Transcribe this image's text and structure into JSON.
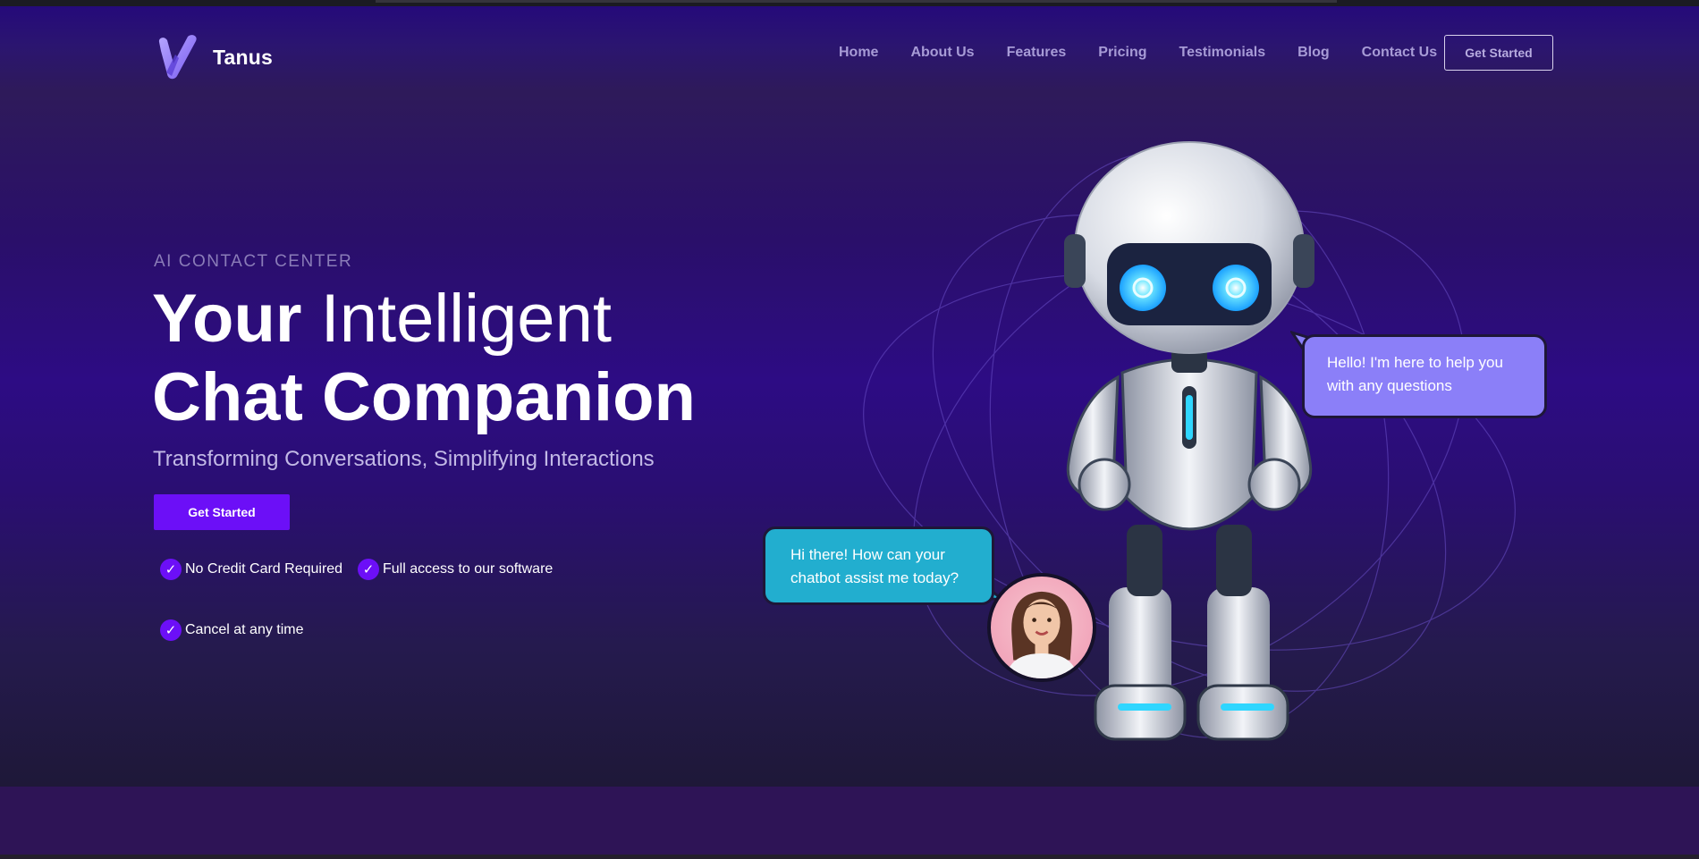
{
  "brand": {
    "name": "Tanus",
    "logo_icon": "v-logo-icon"
  },
  "nav": {
    "items": [
      {
        "label": "Home"
      },
      {
        "label": "About Us"
      },
      {
        "label": "Features"
      },
      {
        "label": "Pricing"
      },
      {
        "label": "Testimonials"
      },
      {
        "label": "Blog"
      },
      {
        "label": "Contact Us"
      }
    ],
    "cta_label": "Get Started"
  },
  "hero": {
    "eyebrow": "AI CONTACT CENTER",
    "title_line1_bold": "Your",
    "title_line1_light": "Intelligent",
    "title_line2": "Chat Companion",
    "subtitle": "Transforming Conversations, Simplifying Interactions",
    "cta_label": "Get Started",
    "checks": [
      {
        "label": "No Credit Card Required",
        "icon": "check-icon"
      },
      {
        "label": "Full access to our software",
        "icon": "check-icon"
      },
      {
        "label": "Cancel at any time",
        "icon": "check-icon"
      }
    ]
  },
  "illustration": {
    "bot_message": "Hello! I'm here to help you with any questions",
    "user_message": "Hi there! How can your chatbot assist me today?",
    "robot_icon": "robot-illustration",
    "avatar_icon": "woman-avatar"
  },
  "colors": {
    "accent": "#6c0ff7",
    "bot_bubble": "#8b7ff8",
    "user_bubble": "#22aecf",
    "nav_text": "#a79bd6"
  }
}
